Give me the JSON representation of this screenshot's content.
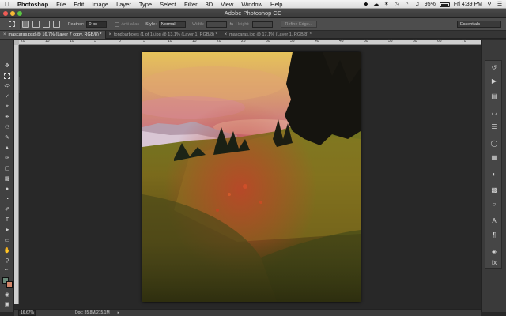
{
  "menubar": {
    "apple": "",
    "items": [
      "Photoshop",
      "File",
      "Edit",
      "Image",
      "Layer",
      "Type",
      "Select",
      "Filter",
      "3D",
      "View",
      "Window",
      "Help"
    ],
    "battery": "95%",
    "clock": "Fri 4:39 PM"
  },
  "window": {
    "title": "Adobe Photoshop CC"
  },
  "options": {
    "feather_label": "Feather:",
    "feather_value": "0 px",
    "antialias_label": "Anti-alias",
    "style_label": "Style:",
    "style_value": "Normal",
    "width_label": "Width:",
    "height_label": "Height:",
    "refine_label": "Refine Edge...",
    "workspace": "Essentials"
  },
  "tabs": [
    {
      "label": "mascaras.psd @ 16.7% (Layer 7 copy, RGB/8) *",
      "active": true
    },
    {
      "label": "fondoarboles (1 of 1).jpg @ 13.1% (Layer 1, RGB/8) *",
      "active": false
    },
    {
      "label": "mascaras.jpg @ 17.1% (Layer 1, RGB/8) *",
      "active": false
    }
  ],
  "ruler": {
    "top": [
      "20",
      "15",
      "10",
      "5",
      "0",
      "5",
      "10",
      "15",
      "20",
      "25",
      "30",
      "35",
      "40",
      "45",
      "50",
      "55",
      "60",
      "65",
      "70"
    ]
  },
  "status": {
    "zoom": "16.67%",
    "doc": "Doc: 35.8M/215.1M"
  },
  "colors": {
    "foreground": "#6a8a7a",
    "background": "#d2866a",
    "panel_bg": "#282828"
  },
  "icons": {
    "left_tools": [
      "move-icon",
      "marquee-icon",
      "lasso-icon",
      "quick-select-icon",
      "crop-icon",
      "eyedropper-icon",
      "spot-healing-icon",
      "brush-icon",
      "clone-stamp-icon",
      "history-brush-icon",
      "eraser-icon",
      "gradient-icon",
      "blur-icon",
      "dodge-icon",
      "pen-icon",
      "type-icon",
      "path-select-icon",
      "shape-icon",
      "hand-icon",
      "zoom-icon"
    ],
    "right_panel": [
      "history-icon",
      "actions-icon",
      "histogram-icon",
      "adjustments-icon",
      "properties-icon",
      "layers-icon",
      "channels-icon",
      "paths-icon",
      "swatches-icon",
      "color-icon",
      "character-icon",
      "paragraph-icon",
      "libraries-icon",
      "styles-icon"
    ]
  }
}
